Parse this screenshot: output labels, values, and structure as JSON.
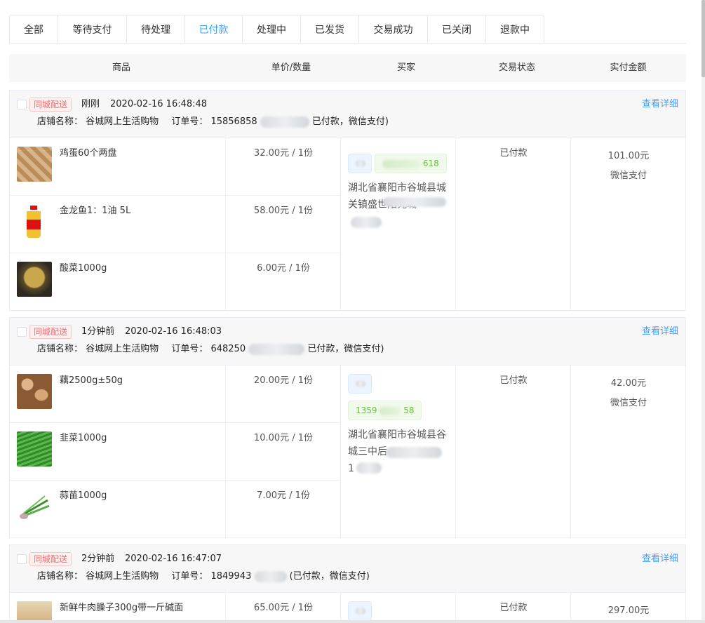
{
  "tabs": [
    {
      "label": "全部"
    },
    {
      "label": "等待支付"
    },
    {
      "label": "待处理"
    },
    {
      "label": "已付款"
    },
    {
      "label": "处理中"
    },
    {
      "label": "已发货"
    },
    {
      "label": "交易成功"
    },
    {
      "label": "已关闭"
    },
    {
      "label": "退款中"
    }
  ],
  "active_tab": "已付款",
  "table_header": {
    "goods": "商品",
    "price_qty": "单价/数量",
    "buyer": "买家",
    "trade_status": "交易状态",
    "paid_amount": "实付金额"
  },
  "orders": [
    {
      "tag": "同城配送",
      "time_ago": "刚刚",
      "datetime": "2020-02-16 16:48:48",
      "detail_link": "查看详细",
      "shop_label": "店铺名称：",
      "shop_name": "谷城网上生活购物",
      "order_no_label": "订单号：",
      "order_no": "15856858",
      "order_suffix": "已付款，微信支付)",
      "items": [
        {
          "name": "鸡蛋60个两盘",
          "price": "32.00元 / 1份"
        },
        {
          "name": "金龙鱼1：1油 5L",
          "price": "58.00元 / 1份"
        },
        {
          "name": "酸菜1000g",
          "price": "6.00元 / 1份"
        }
      ],
      "buyer_phone": "618",
      "buyer_address": "湖北省襄阳市谷城县城关镇盛世阳光城",
      "status": "已付款",
      "amount": "101.00元",
      "pay_method": "微信支付"
    },
    {
      "tag": "同城配送",
      "time_ago": "1分钟前",
      "datetime": "2020-02-16 16:48:03",
      "detail_link": "查看详细",
      "shop_label": "店铺名称：",
      "shop_name": "谷城网上生活购物",
      "order_no_label": "订单号：",
      "order_no": "648250",
      "order_suffix": "已付款，微信支付)",
      "items": [
        {
          "name": "藕2500g±50g",
          "price": "20.00元 / 1份"
        },
        {
          "name": "韭菜1000g",
          "price": "10.00元 / 1份"
        },
        {
          "name": "蒜苗1000g",
          "price": "7.00元 / 1份"
        }
      ],
      "buyer_phone_start": "1359",
      "buyer_phone_end": "58",
      "buyer_address": "湖北省襄阳市谷城县谷城三中后",
      "buyer_address_2": "1",
      "status": "已付款",
      "amount": "42.00元",
      "pay_method": "微信支付"
    },
    {
      "tag": "同城配送",
      "time_ago": "2分钟前",
      "datetime": "2020-02-16 16:47:07",
      "detail_link": "查看详细",
      "shop_label": "店铺名称：",
      "shop_name": "谷城网上生活购物",
      "order_no_label": "订单号：",
      "order_no": "1849943",
      "order_suffix": "(已付款，微信支付)",
      "items": [
        {
          "name": "新鲜牛肉臊子300g带一斤碱面",
          "price": "65.00元 / 1份"
        }
      ],
      "status": "已付款",
      "amount": "297.00元"
    }
  ]
}
